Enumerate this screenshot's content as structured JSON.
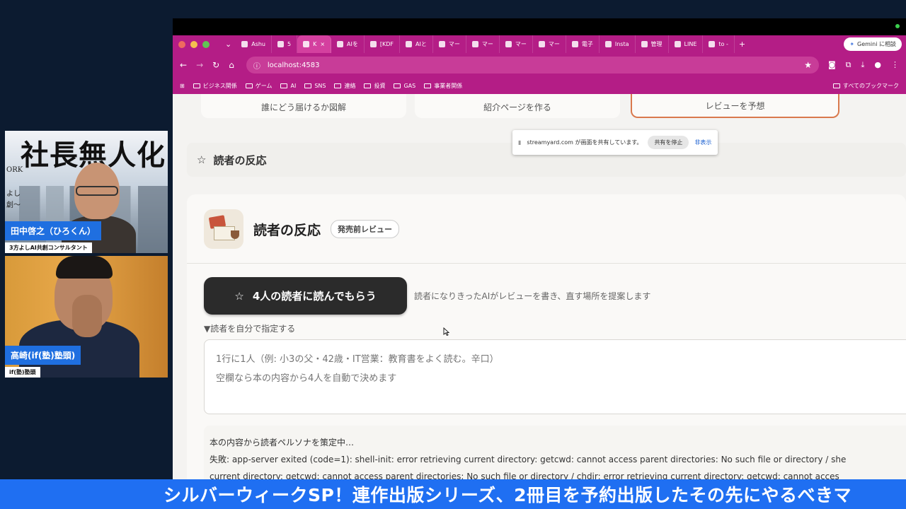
{
  "participants": [
    {
      "name": "田中啓之（ひろくん）",
      "role": "3方よしAI共創コンサルタント"
    },
    {
      "name": "高崎(if(塾)塾頭)",
      "role": "if(塾)塾頭"
    }
  ],
  "background_book": {
    "title": "社長無人化",
    "side_lines": [
      "ORK",
      "よし",
      "創〜"
    ]
  },
  "browser": {
    "tabs": [
      {
        "label": "Ashu"
      },
      {
        "label": "5"
      },
      {
        "label": "K",
        "active": true
      },
      {
        "label": "AIを"
      },
      {
        "label": "[KDF"
      },
      {
        "label": "AIと"
      },
      {
        "label": "マー"
      },
      {
        "label": "マー"
      },
      {
        "label": "マー"
      },
      {
        "label": "マー"
      },
      {
        "label": "電子"
      },
      {
        "label": "Insta"
      },
      {
        "label": "管理"
      },
      {
        "label": "LINE"
      },
      {
        "label": "to -"
      }
    ],
    "gemini_label": "Gemini に相談",
    "url": "localhost:4583",
    "bookmarks": [
      "ビジネス関係",
      "ゲーム",
      "AI",
      "SNS",
      "連絡",
      "投資",
      "GAS",
      "事業者関係"
    ],
    "all_bookmarks": "すべてのブックマーク"
  },
  "page": {
    "top_cards": [
      "誰にどう届けるか図解",
      "紹介ページを作る",
      "レビューを予想"
    ],
    "section_label": "読者の反応",
    "share_notice": {
      "text": "streamyard.com が画面を共有しています。",
      "stop": "共有を停止",
      "hide": "非表示"
    },
    "panel_title": "読者の反応",
    "badge": "発売前レビュー",
    "primary_button": "4人の読者に読んでもらう",
    "button_hint": "読者になりきったAIがレビューを書き、直す場所を提案します",
    "toggle": "▼読者を自分で指定する",
    "textarea_placeholder": "1行に1人（例: 小3の父・42歳・IT営業：教育書をよく読む。辛口）\n空欄なら本の内容から4人を自動で決めます",
    "log": [
      "本の内容から読者ペルソナを策定中…",
      "失敗: app-server exited (code=1): shell-init: error retrieving current directory: getcwd: cannot access parent directories: No such file or directory / she",
      "current directory: getcwd: cannot access parent directories: No such file or directory / chdir: error retrieving current directory: getcwd: cannot acces"
    ]
  },
  "ticker": "シルバーウィークSP！連作出版シリーズ、2冊目を予約出版したその先にやるべきマ"
}
